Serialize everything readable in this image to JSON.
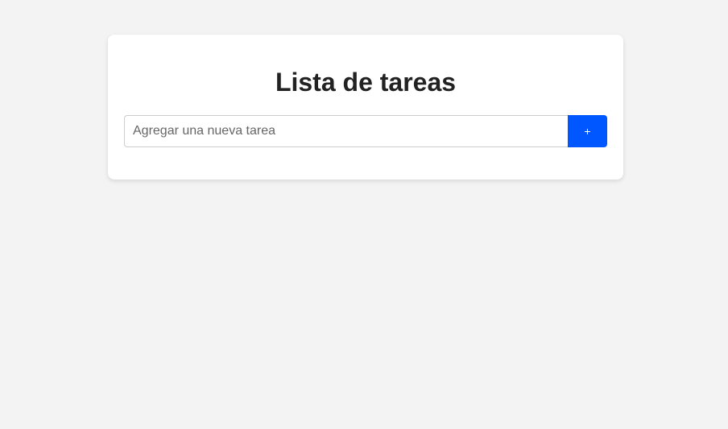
{
  "app": {
    "title": "Lista de tareas"
  },
  "task_input": {
    "value": "",
    "placeholder": "Agregar una nueva tarea"
  },
  "add_button": {
    "label": "+"
  },
  "colors": {
    "background": "#f3f3f3",
    "card": "#ffffff",
    "accent": "#0056ff",
    "title_text": "#222222"
  }
}
